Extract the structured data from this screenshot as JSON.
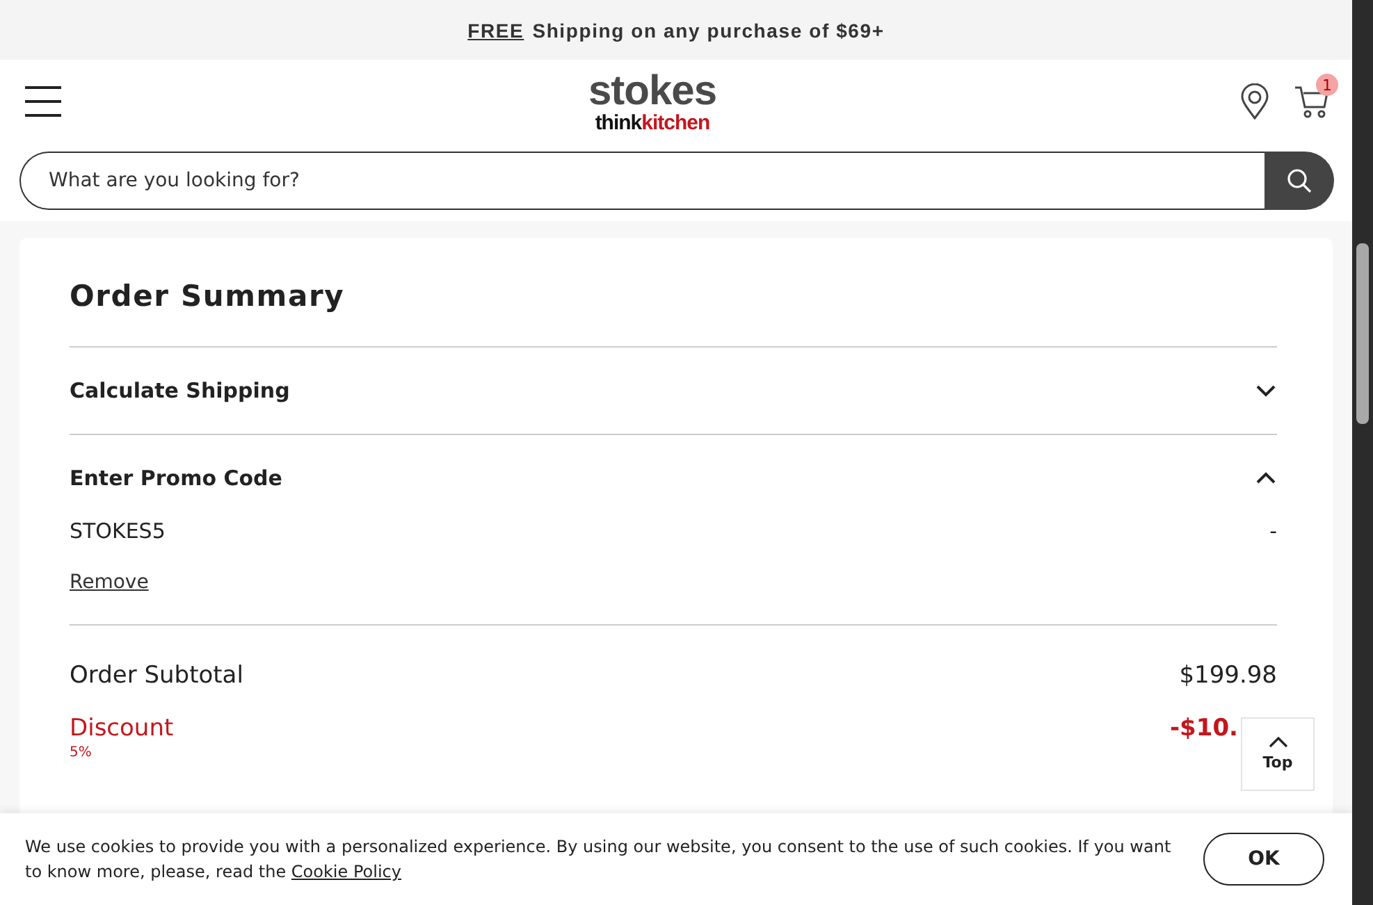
{
  "banner": {
    "free": "FREE",
    "text": "Shipping on any purchase of $69+"
  },
  "header": {
    "logo": {
      "brand": "stokes",
      "sub_dark": "think",
      "sub_red": "kitchen"
    },
    "cart_count": "1"
  },
  "search": {
    "placeholder": "What are you looking for?"
  },
  "summary": {
    "title": "Order Summary",
    "sections": [
      {
        "label": "Calculate Shipping",
        "expanded": false
      },
      {
        "label": "Enter Promo Code",
        "expanded": true,
        "promo": {
          "code": "STOKES5",
          "value": "-",
          "action": "Remove"
        }
      }
    ],
    "totals": [
      {
        "kind": "normal",
        "label": "Order Subtotal",
        "amount": "$199.98"
      },
      {
        "kind": "discount",
        "label": "Discount",
        "note": "5%",
        "amount": "-$10."
      }
    ]
  },
  "top_button": "Top",
  "cookie": {
    "text": "We use cookies to provide you with a personalized experience. By using our website, you consent to the use of such cookies. If you want to know more, please, read the",
    "link": "Cookie Policy",
    "button": "OK"
  }
}
